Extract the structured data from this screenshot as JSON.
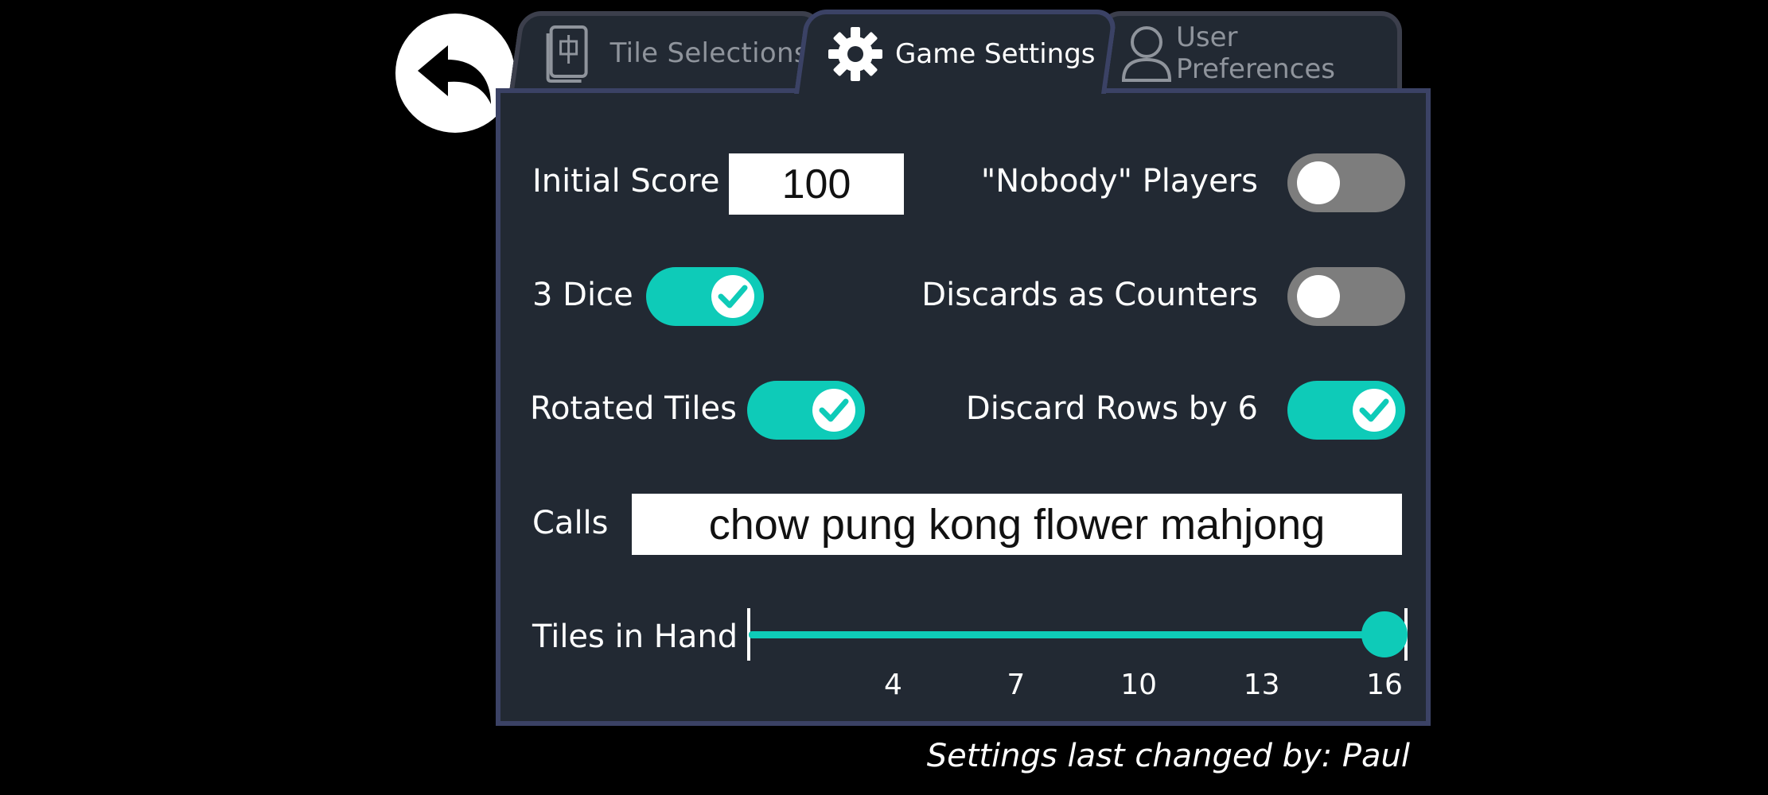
{
  "tabs": {
    "tiles": {
      "label": "Tile Selections",
      "icon": "mahjong-tile-icon"
    },
    "game": {
      "label": "Game Settings",
      "icon": "gear-icon"
    },
    "prefs": {
      "label": "User Preferences",
      "icon": "user-icon"
    }
  },
  "back_button": {
    "icon": "back-arrow-icon"
  },
  "settings": {
    "initial_score": {
      "label": "Initial Score",
      "value": "100"
    },
    "nobody_players": {
      "label": "\"Nobody\" Players",
      "on": false
    },
    "three_dice": {
      "label": "3 Dice",
      "on": true
    },
    "discards_as_counters": {
      "label": "Discards as Counters",
      "on": false
    },
    "rotated_tiles": {
      "label": "Rotated Tiles",
      "on": true
    },
    "discard_rows_by_6": {
      "label": "Discard Rows by 6",
      "on": true
    },
    "calls": {
      "label": "Calls",
      "value": "chow pung kong flower mahjong"
    },
    "tiles_in_hand": {
      "label": "Tiles in Hand",
      "value": 16,
      "min": 1,
      "max": 16,
      "ticks": [
        "4",
        "7",
        "10",
        "13",
        "16"
      ]
    }
  },
  "footer": {
    "note": "Settings last changed by: Paul"
  },
  "colors": {
    "accent": "#0ecbb8",
    "panel": "#222933",
    "border": "#3b4265",
    "toggle_off": "#7d7d7d"
  }
}
